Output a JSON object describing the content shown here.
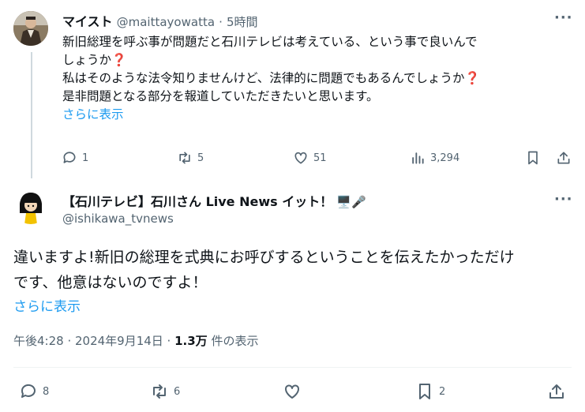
{
  "reply": {
    "name": "マイスト",
    "handle": "@maittayowatta",
    "sep": "·",
    "time": "5時間",
    "line1": "新旧総理を呼ぶ事が問題だと石川テレビは考えている、という事で良いんで",
    "line2": "しょうか❓",
    "line3": "私はそのような法令知りませんけど、法律的に問題でもあるんでしょうか❓",
    "line4": "是非問題となる部分を報道していただきたいと思います。",
    "show_more": "さらに表示",
    "replies": "1",
    "reposts": "5",
    "likes": "51",
    "views": "3,294"
  },
  "main": {
    "name": "【石川テレビ】石川さん Live News イット！",
    "name_emoji": "🖥️🎤",
    "handle": "@ishikawa_tvnews",
    "line1": "違いますよ!新旧の総理を式典にお呼びするということを伝えたかっただけ",
    "line2": "です、他意はないのですよ！",
    "show_more": "さらに表示",
    "timestamp": "午後4:28 · 2024年9月14日 · ",
    "view_count": "1.3万",
    "view_label": " 件の表示",
    "replies": "8",
    "reposts": "6",
    "likes": "",
    "bookmarks": "2"
  },
  "icons": [
    "more-icon",
    "reply-icon",
    "repost-icon",
    "like-icon",
    "views-icon",
    "bookmark-icon",
    "share-icon"
  ],
  "colors": {
    "link": "#1d9bf0",
    "secondary": "#536471",
    "text": "#0f1419",
    "divider": "#eff3f4"
  }
}
